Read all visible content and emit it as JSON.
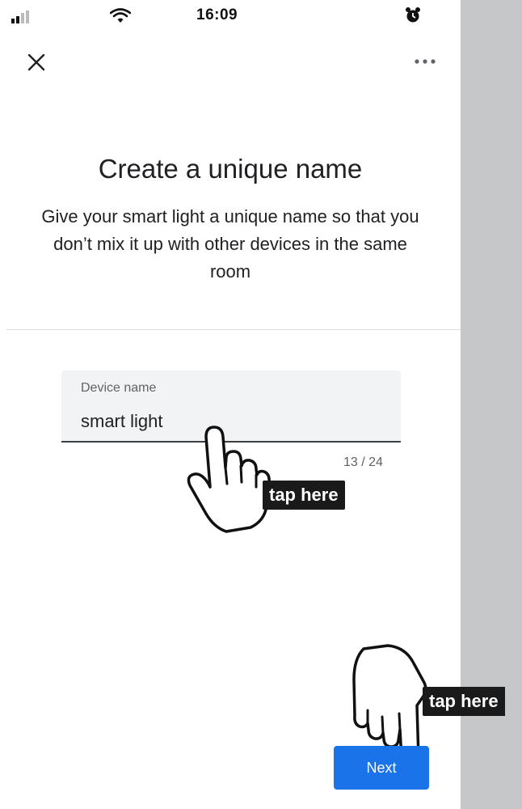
{
  "status_bar": {
    "time": "16:09",
    "icons": [
      "cellular-signal-icon",
      "wifi-icon",
      "alarm-clock-icon"
    ]
  },
  "top_bar": {
    "close_icon": "close-icon",
    "more_icon": "more-horizontal-icon"
  },
  "content": {
    "title": "Create a unique name",
    "subtitle": "Give your smart light a unique name so that you don’t mix it up with other devices in the same room"
  },
  "device_name_field": {
    "label": "Device name",
    "value": "smart light",
    "counter": "13 / 24"
  },
  "annotations": {
    "field_callout": "tap here",
    "next_callout": "tap here",
    "hand_icon": "pointing-hand-icon"
  },
  "footer": {
    "next_label": "Next"
  },
  "colors": {
    "primary": "#1a73e8",
    "side_panel": "#c6c7c9",
    "callout_bg": "#1a1a1a",
    "field_bg": "#f1f3f4"
  }
}
